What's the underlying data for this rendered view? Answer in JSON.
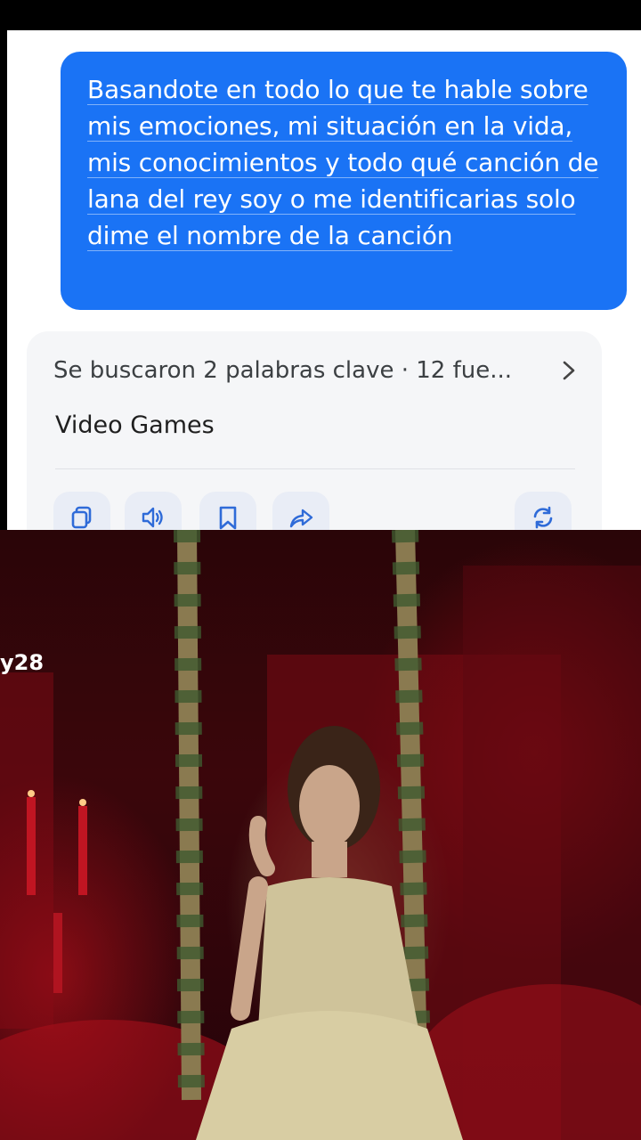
{
  "chat": {
    "user_message": "Basandote en todo lo que te hable sobre mis emociones, mi situación en la vida, mis conocimientos y todo qué canción de lana del rey soy o me identificarias solo dime el nombre de la canción",
    "search_summary": "Se buscaron 2 palabras clave · 12 fue...",
    "answer": "Video Games",
    "actions": [
      "copy-icon",
      "speaker-icon",
      "bookmark-icon",
      "share-icon",
      "refresh-icon"
    ]
  },
  "video": {
    "watermark_text": "y28"
  },
  "colors": {
    "user_bubble": "#1a73f5",
    "card_background": "#f5f6f8",
    "icon_blue": "#2f6bd8",
    "video_red": "#3b060b"
  }
}
